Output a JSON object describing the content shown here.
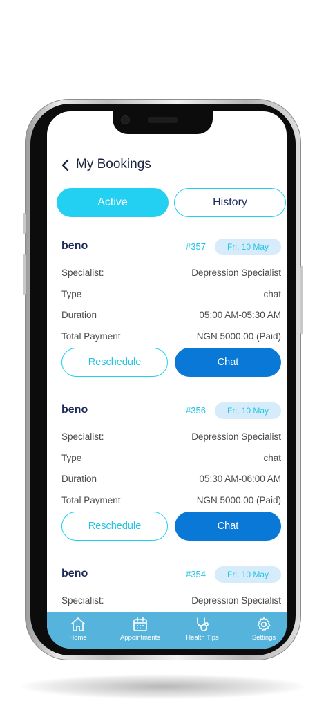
{
  "header": {
    "title": "My Bookings"
  },
  "tabs": [
    {
      "label": "Active",
      "active": true
    },
    {
      "label": "History",
      "active": false
    }
  ],
  "field_labels": {
    "specialist": "Specialist:",
    "type": "Type",
    "duration": "Duration",
    "payment": "Total Payment"
  },
  "buttons": {
    "reschedule": "Reschedule",
    "chat": "Chat"
  },
  "bookings": [
    {
      "user": "beno",
      "id": "#357",
      "date": "Fri, 10 May",
      "specialist": "Depression Specialist",
      "type": "chat",
      "duration": "05:00 AM-05:30 AM",
      "payment": "NGN 5000.00 (Paid)"
    },
    {
      "user": "beno",
      "id": "#356",
      "date": "Fri, 10 May",
      "specialist": "Depression Specialist",
      "type": "chat",
      "duration": "05:30 AM-06:00 AM",
      "payment": "NGN 5000.00 (Paid)"
    },
    {
      "user": "beno",
      "id": "#354",
      "date": "Fri, 10 May",
      "specialist": "Depression Specialist"
    }
  ],
  "nav": [
    {
      "label": "Home",
      "icon": "home-icon"
    },
    {
      "label": "Appointments",
      "icon": "calendar-icon"
    },
    {
      "label": "Health Tips",
      "icon": "stethoscope-icon"
    },
    {
      "label": "Settings",
      "icon": "gear-icon"
    }
  ],
  "colors": {
    "accent": "#23d0f1",
    "primary": "#0a78d6",
    "nav_bar": "#56b4dc",
    "badge_bg": "#d6ecfb",
    "title": "#1c2a5a"
  }
}
